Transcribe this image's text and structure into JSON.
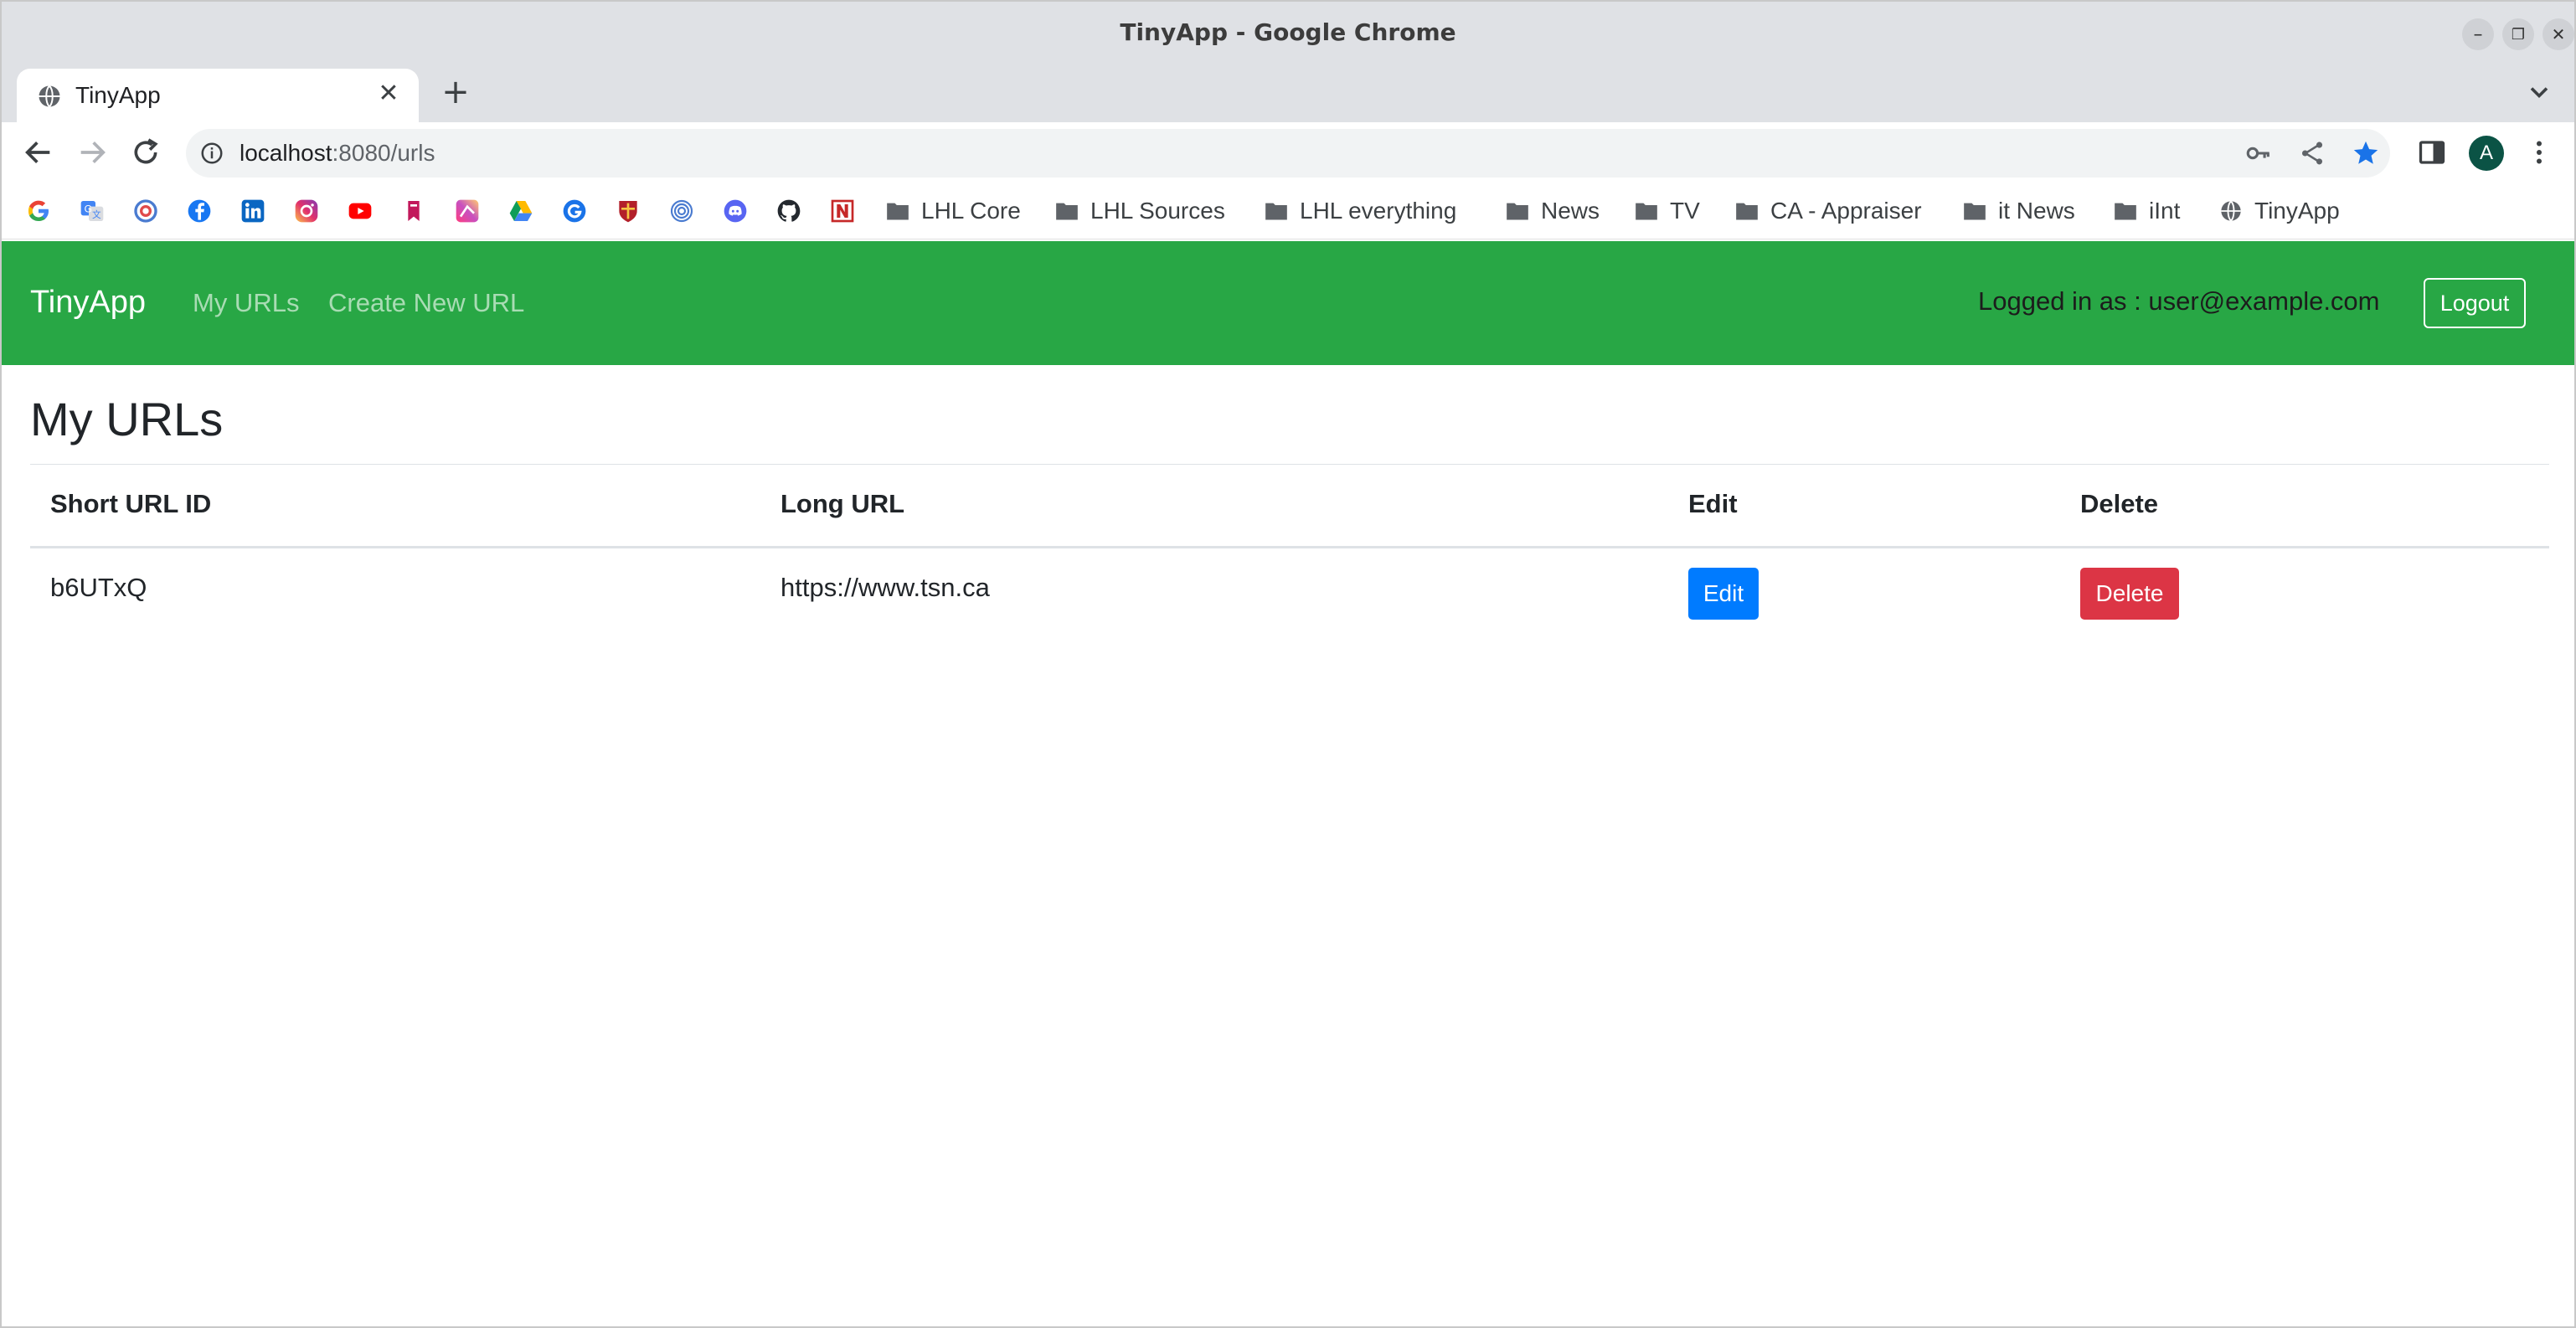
{
  "window": {
    "title": "TinyApp - Google Chrome",
    "minimize_glyph": "–",
    "restore_glyph": "❐",
    "close_glyph": "✕"
  },
  "tabs": [
    {
      "title": "TinyApp",
      "close_glyph": "✕"
    }
  ],
  "new_tab_glyph": "+",
  "address_bar": {
    "host": "localhost",
    "path": ":8080/urls"
  },
  "profile": {
    "initial": "A",
    "color": "#0b5345"
  },
  "bookmarks": {
    "icons": [
      "google-icon",
      "google-translate-icon",
      "loop-icon",
      "facebook-icon",
      "linkedin-icon",
      "instagram-icon",
      "youtube-icon",
      "bookmark-red-icon",
      "gradient-app-icon",
      "google-drive-icon",
      "grammarly-icon",
      "crest-icon",
      "fingerprint-icon",
      "discord-icon",
      "github-icon",
      "netflix-n-icon"
    ],
    "folders": [
      "LHL Core",
      "LHL Sources",
      "LHL everything",
      "News",
      "TV",
      "CA - Appraiser",
      "it News",
      "iInt"
    ],
    "pages": [
      "TinyApp"
    ]
  },
  "app": {
    "brand": "TinyApp",
    "nav": {
      "my_urls": "My URLs",
      "create_new_url": "Create New URL"
    },
    "logged_in_text": "Logged in as : user@example.com",
    "logout_label": "Logout",
    "navbar_color": "#28a745",
    "page_title": "My URLs",
    "table": {
      "headers": [
        "Short URL ID",
        "Long URL",
        "Edit",
        "Delete"
      ],
      "rows": [
        {
          "short_id": "b6UTxQ",
          "long_url": "https://www.tsn.ca",
          "edit_label": "Edit",
          "delete_label": "Delete"
        }
      ]
    },
    "colors": {
      "edit_button": "#007bff",
      "delete_button": "#dc3545"
    }
  }
}
